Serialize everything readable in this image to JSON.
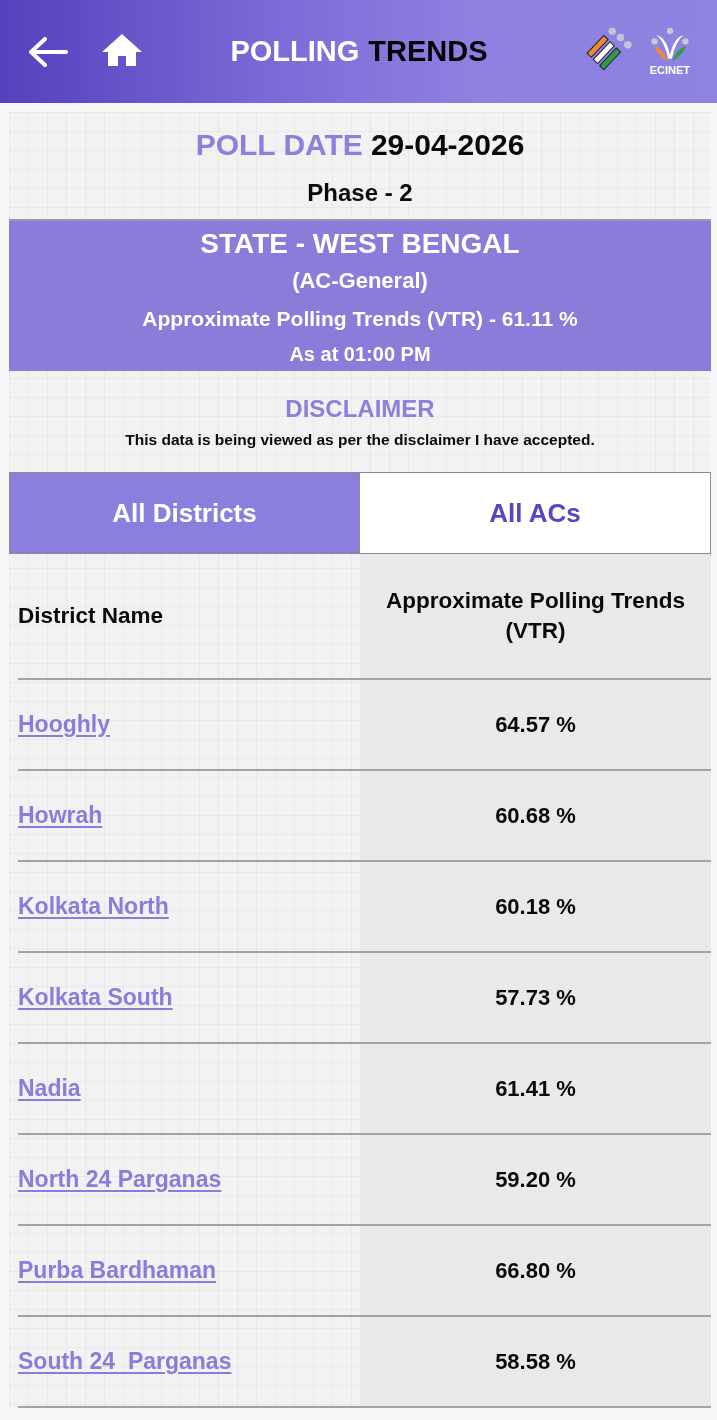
{
  "header": {
    "title_lead": "POLLING",
    "title_rest": "TRENDS",
    "logo_caption": "ECINET"
  },
  "poll": {
    "date_label": "POLL DATE",
    "date": "29-04-2026",
    "phase": "Phase - 2"
  },
  "banner": {
    "state": "STATE - WEST BENGAL",
    "election_type": "(AC-General)",
    "overall": "Approximate Polling Trends (VTR) - 61.11 %",
    "as_at": "As at 01:00 PM"
  },
  "disclaimer": {
    "title": "DISCLAIMER",
    "text": "This data is being viewed as per the disclaimer I have accepted."
  },
  "tabs": [
    {
      "label": "All Districts",
      "selected": true
    },
    {
      "label": "All ACs",
      "selected": false
    }
  ],
  "table": {
    "columns": [
      "District Name",
      "Approximate Polling Trends (VTR)"
    ],
    "rows": [
      {
        "district": "Hooghly",
        "turnout": "64.57 %"
      },
      {
        "district": "Howrah",
        "turnout": "60.68 %"
      },
      {
        "district": "Kolkata North",
        "turnout": "60.18 %"
      },
      {
        "district": "Kolkata South",
        "turnout": "57.73 %"
      },
      {
        "district": "Nadia",
        "turnout": "61.41 %"
      },
      {
        "district": "North 24 Parganas",
        "turnout": "59.20 %"
      },
      {
        "district": "Purba Bardhaman",
        "turnout": "66.80 %"
      },
      {
        "district": "South 24  Parganas",
        "turnout": "58.58 %"
      }
    ]
  }
}
